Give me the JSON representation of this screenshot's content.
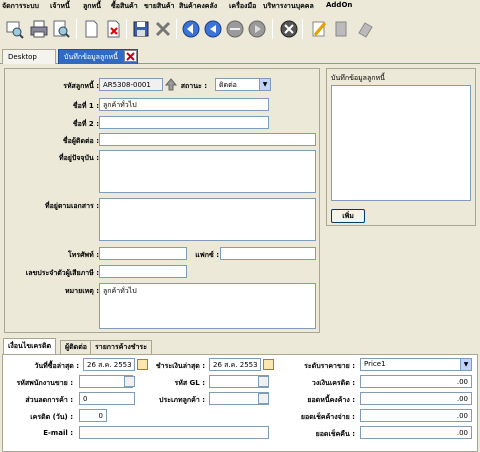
{
  "menu": [
    "จัดการระบบ",
    "เจ้าหนี้",
    "ลูกหนี้",
    "ซื้อสินค้า",
    "ขายสินค้า",
    "สินค้าคงคลัง",
    "เครื่องมือ",
    "บริหารงานบุคคล",
    "AddOn"
  ],
  "doc_tabs": {
    "desktop": "Desktop",
    "customer": "บันทึกข้อมูลลูกหนี้"
  },
  "form": {
    "code_label": "รหัสลูกหนี้ :",
    "code_value": "AR5308-0001",
    "status_label": "สถานะ :",
    "status_value": "ติดต่อ",
    "name1_label": "ชื่อที่ 1 :",
    "name1_value": "ลูกค้าทั่วไป",
    "name2_label": "ชื่อที่ 2 :",
    "name2_value": "",
    "contact_label": "ชื่อผู้ติดต่อ :",
    "contact_value": "",
    "address_label": "ที่อยู่ปัจจุบัน :",
    "doc_address_label": "ที่อยู่ตามเอกสาร :",
    "phone_label": "โทรศัพท์ :",
    "fax_label": "แฟกซ์ :",
    "taxid_label": "เลขประจำตัวผู้เสียภาษี :",
    "note_label": "หมายเหตุ :",
    "note_value": "ลูกค้าทั่วไป"
  },
  "notes_panel": {
    "title": "บันทึกข้อมูลลูกหนี้",
    "add_button": "เพิ่ม"
  },
  "sub_tabs": [
    "เงื่อนไขเครดิต",
    "ผู้ติดต่อ",
    "รายการค้างชำระ"
  ],
  "credit": {
    "last_sale_label": "วันที่ซื้อล่าสุด :",
    "last_sale_value": "26 ส.ค. 2553",
    "last_pay_label": "ชำระเงินล่าสุด :",
    "last_pay_value": "26 ส.ค. 2553",
    "price_level_label": "ระดับราคาขาย :",
    "price_level_value": "Price1",
    "salesman_label": "รหัสพนักงานขาย :",
    "gl_label": "รหัส GL :",
    "credit_limit_label": "วงเงินเครดิต :",
    "credit_limit_value": ".00",
    "discount_label": "ส่วนลดการค้า :",
    "discount_value": "0",
    "customer_type_label": "ประเภทลูกค้า :",
    "balance_label": "ยอดหนี้คงค้าง :",
    "balance_value": ".00",
    "credit_days_label": "เครดิต (วัน) :",
    "credit_days_value": "0",
    "cheque_pending_label": "ยอดเช็คค้างจ่าย :",
    "cheque_pending_value": ".00",
    "email_label": "E-mail :",
    "cheque_return_label": "ยอดเช็คคืน :",
    "cheque_return_value": ".00"
  }
}
